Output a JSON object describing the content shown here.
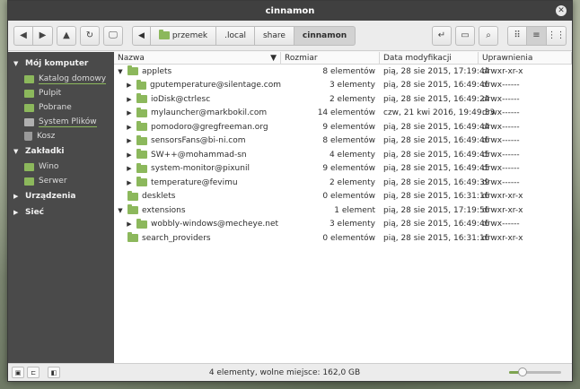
{
  "window": {
    "title": "cinnamon"
  },
  "toolbar": {
    "path": [
      {
        "label": "przemek",
        "icon": "home-folder-icon"
      },
      {
        "label": ".local"
      },
      {
        "label": "share"
      },
      {
        "label": "cinnamon",
        "active": true
      }
    ]
  },
  "sidebar": {
    "sections": [
      {
        "title": "Mój komputer",
        "expanded": true,
        "items": [
          {
            "label": "Katalog domowy",
            "icon": "folder-icon"
          },
          {
            "label": "Pulpit",
            "icon": "folder-icon"
          },
          {
            "label": "Pobrane",
            "icon": "folder-icon"
          },
          {
            "label": "System Plików",
            "icon": "drive-icon"
          },
          {
            "label": "Kosz",
            "icon": "trash-icon"
          }
        ]
      },
      {
        "title": "Zakładki",
        "expanded": true,
        "items": [
          {
            "label": "Wino",
            "icon": "folder-icon"
          },
          {
            "label": "Serwer",
            "icon": "folder-icon"
          }
        ]
      },
      {
        "title": "Urządzenia",
        "expanded": false,
        "items": []
      },
      {
        "title": "Sieć",
        "expanded": false,
        "items": []
      }
    ]
  },
  "columns": {
    "name": "Nazwa",
    "size": "Rozmiar",
    "date": "Data modyfikacji",
    "perms": "Uprawnienia"
  },
  "files": [
    {
      "level": 0,
      "expander": "open",
      "name": "applets",
      "size": "8 elementów",
      "date": "pią, 28 sie 2015, 17:19:44",
      "perms": "drwxr-xr-x"
    },
    {
      "level": 1,
      "expander": "closed",
      "name": "gputemperature@silentage.com",
      "size": "3 elementy",
      "date": "pią, 28 sie 2015, 16:49:46",
      "perms": "drwx------"
    },
    {
      "level": 1,
      "expander": "closed",
      "name": "ioDisk@ctrlesc",
      "size": "2 elementy",
      "date": "pią, 28 sie 2015, 16:49:24",
      "perms": "drwx------"
    },
    {
      "level": 1,
      "expander": "closed",
      "name": "mylauncher@markbokil.com",
      "size": "14 elementów",
      "date": "czw, 21 kwi 2016, 19:49:33",
      "perms": "drwx------"
    },
    {
      "level": 1,
      "expander": "closed",
      "name": "pomodoro@gregfreeman.org",
      "size": "9 elementów",
      "date": "pią, 28 sie 2015, 16:49:44",
      "perms": "drwx------"
    },
    {
      "level": 1,
      "expander": "closed",
      "name": "sensorsFans@bi-ni.com",
      "size": "8 elementów",
      "date": "pią, 28 sie 2015, 16:49:46",
      "perms": "drwx------"
    },
    {
      "level": 1,
      "expander": "closed",
      "name": "SW++@mohammad-sn",
      "size": "4 elementy",
      "date": "pią, 28 sie 2015, 16:49:45",
      "perms": "drwx------"
    },
    {
      "level": 1,
      "expander": "closed",
      "name": "system-monitor@pixunil",
      "size": "9 elementów",
      "date": "pią, 28 sie 2015, 16:49:45",
      "perms": "drwx------"
    },
    {
      "level": 1,
      "expander": "closed",
      "name": "temperature@fevimu",
      "size": "2 elementy",
      "date": "pią, 28 sie 2015, 16:49:39",
      "perms": "drwx------"
    },
    {
      "level": 0,
      "expander": "none",
      "name": "desklets",
      "size": "0 elementów",
      "date": "pią, 28 sie 2015, 16:31:16",
      "perms": "drwxr-xr-x"
    },
    {
      "level": 0,
      "expander": "open",
      "name": "extensions",
      "size": "1 element",
      "date": "pią, 28 sie 2015, 17:19:56",
      "perms": "drwxr-xr-x"
    },
    {
      "level": 1,
      "expander": "closed",
      "name": "wobbly-windows@mecheye.net",
      "size": "3 elementy",
      "date": "pią, 28 sie 2015, 16:49:46",
      "perms": "drwx------"
    },
    {
      "level": 0,
      "expander": "none",
      "name": "search_providers",
      "size": "0 elementów",
      "date": "pią, 28 sie 2015, 16:31:16",
      "perms": "drwxr-xr-x"
    }
  ],
  "statusbar": {
    "text": "4 elementy, wolne miejsce: 162,0 GB",
    "zoom_level": 0.25
  },
  "colors": {
    "accent": "#8cb85c",
    "sidebar_bg": "#4a4a4a",
    "titlebar_bg": "#404040"
  }
}
